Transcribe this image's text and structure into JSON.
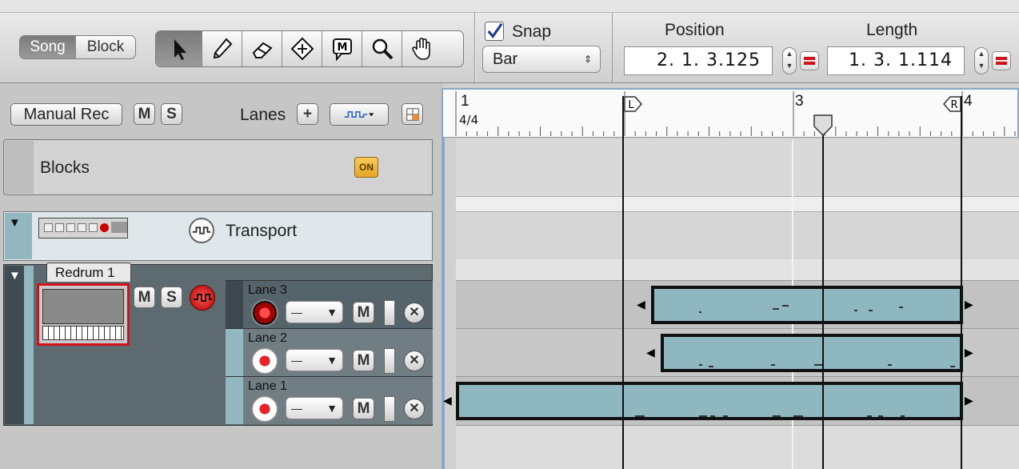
{
  "toolbar": {
    "mode_song": "Song",
    "mode_block": "Block",
    "snap_label": "Snap",
    "snap_checked": true,
    "snap_value": "Bar",
    "position_label": "Position",
    "position_value": "2.  1.  3.125",
    "length_label": "Length",
    "length_value": "1.  3.  1.114"
  },
  "sequencer": {
    "manual_rec": "Manual Rec",
    "mute": "M",
    "solo": "S",
    "lanes_label": "Lanes",
    "add": "+",
    "blocks_label": "Blocks",
    "blocks_on": "ON",
    "transport_label": "Transport",
    "device_name": "Redrum 1",
    "lanes": [
      {
        "label": "Lane 3",
        "mute": "M"
      },
      {
        "label": "Lane 2",
        "mute": "M"
      },
      {
        "label": "Lane 1",
        "mute": "M"
      }
    ]
  },
  "ruler": {
    "bar1": "1",
    "signature": "4/4",
    "bar3": "3",
    "bar4": "4",
    "left_marker": "L",
    "right_marker": "R"
  },
  "colors": {
    "clip_fill": "#8fb7bf",
    "clip_border": "#111111",
    "record_red": "#d1121a",
    "on_button": "#f4b73a"
  }
}
